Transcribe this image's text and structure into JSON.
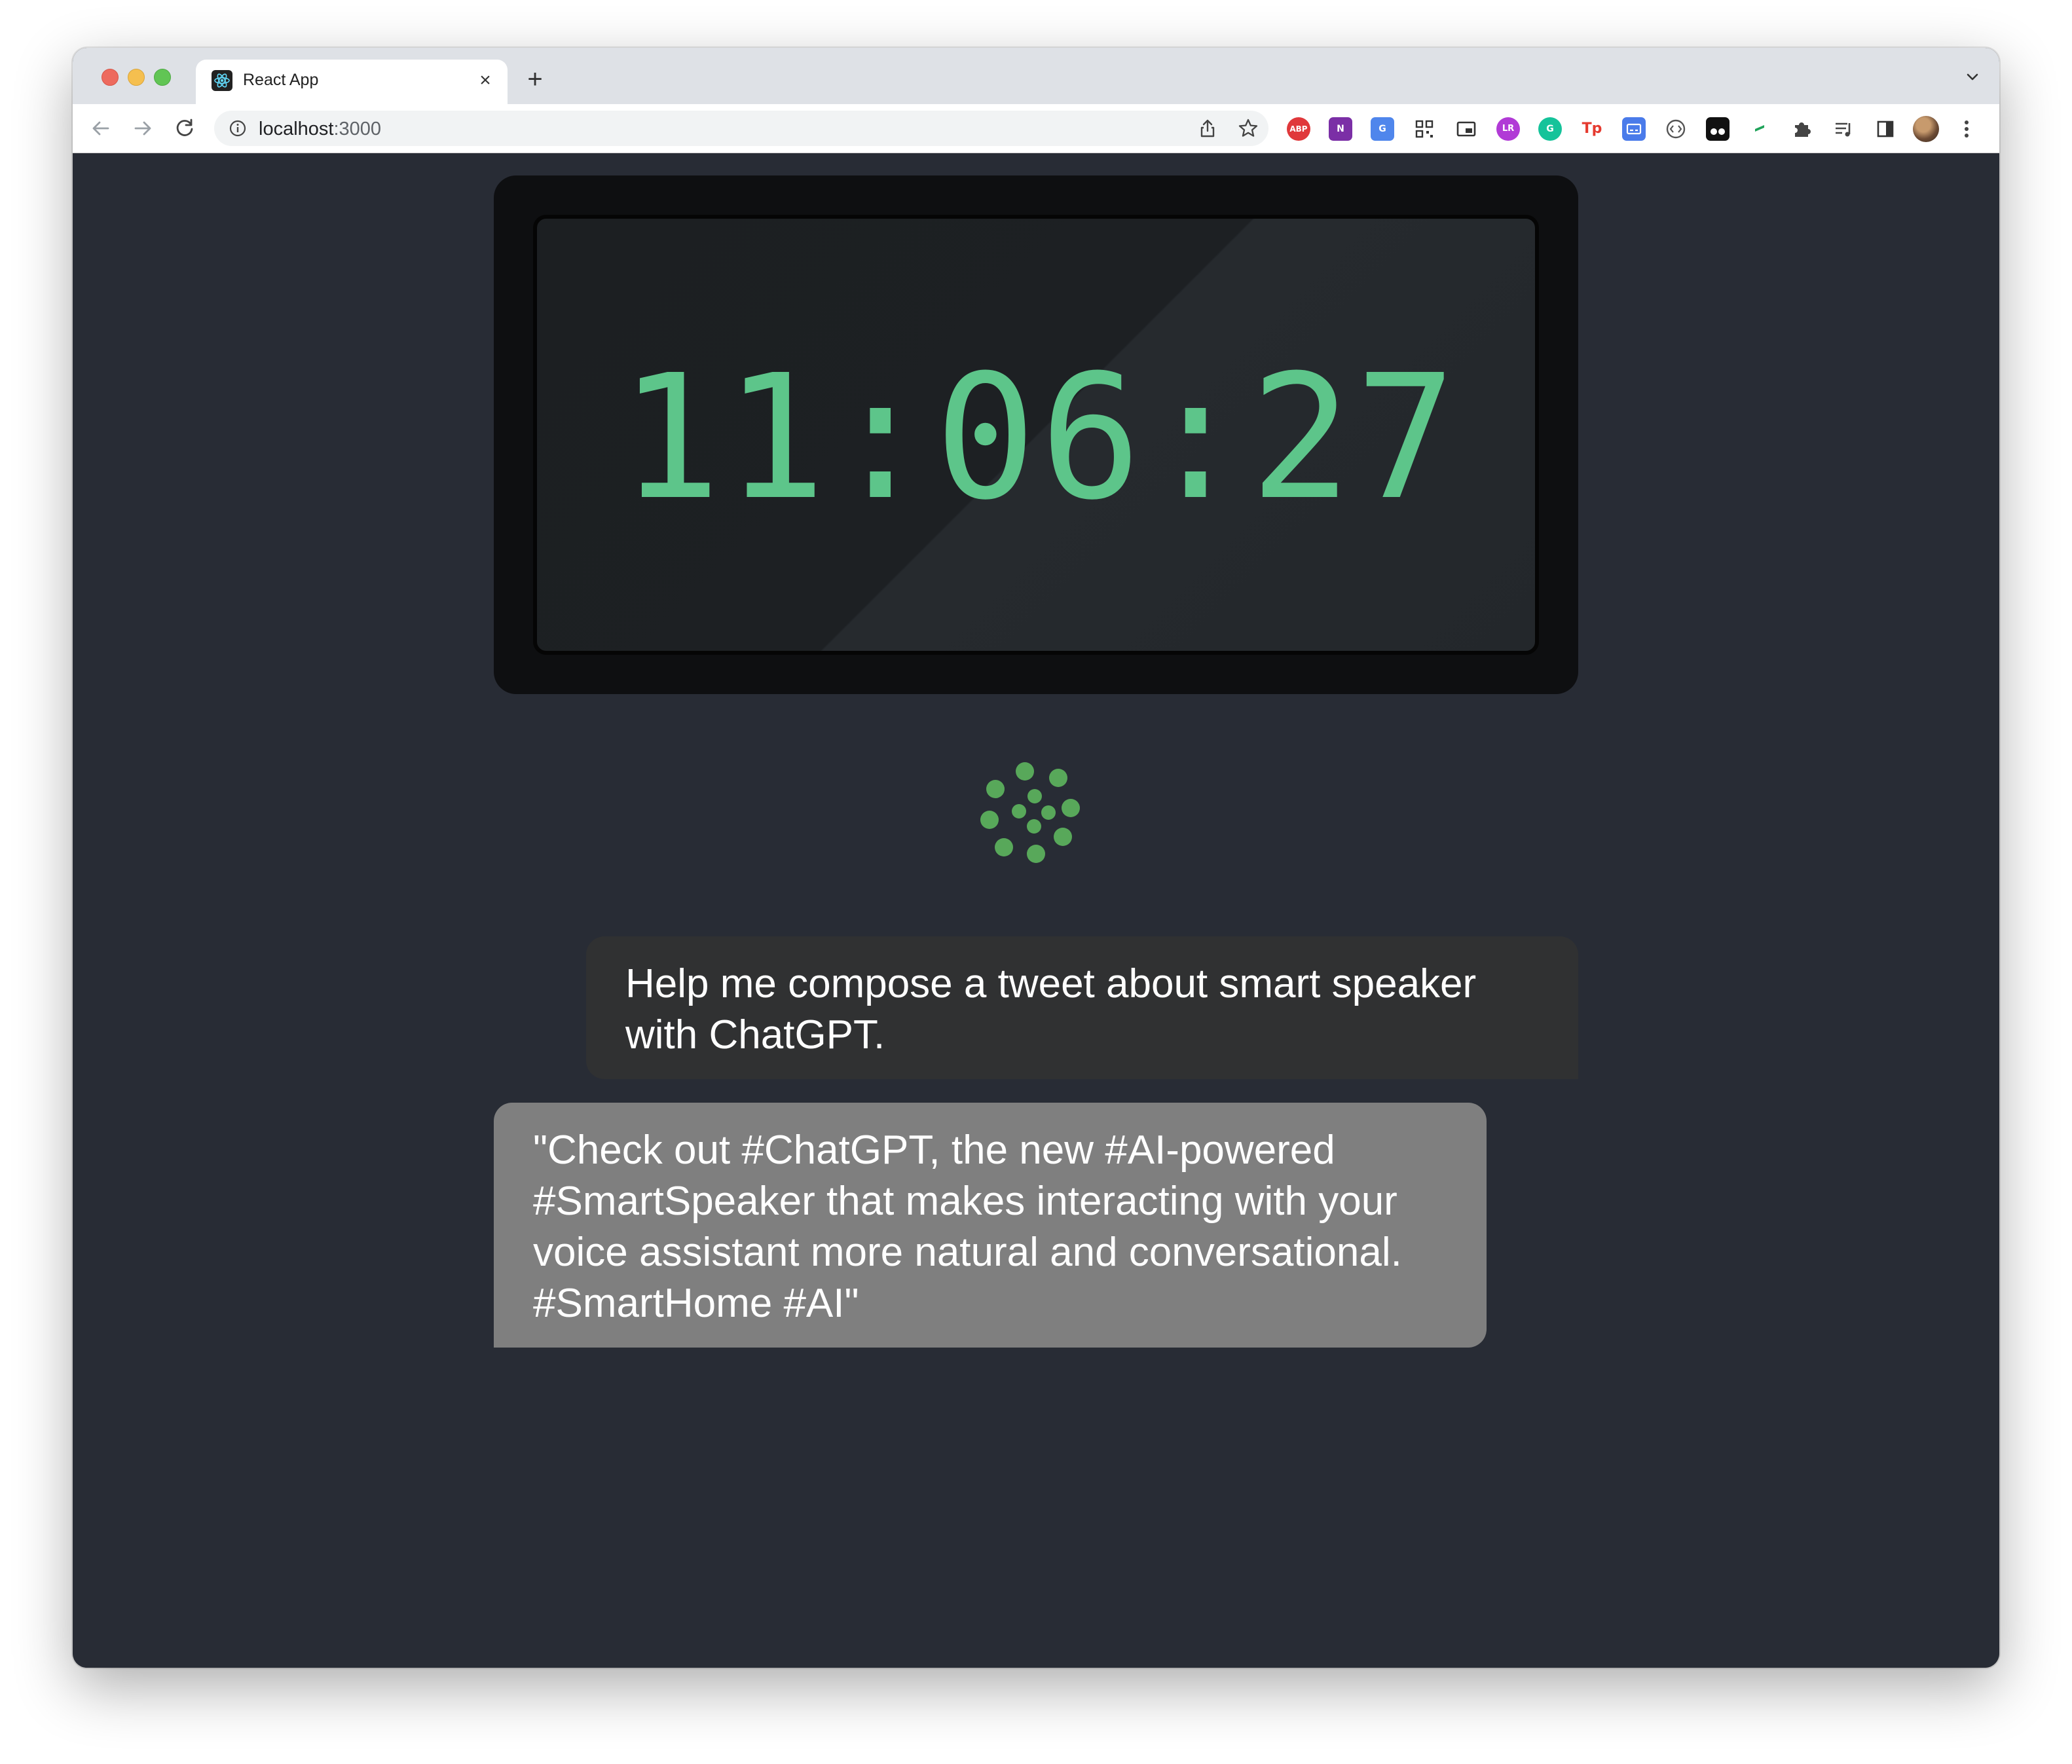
{
  "browser": {
    "tab_title": "React App",
    "tab_close_glyph": "×",
    "new_tab_glyph": "+",
    "url_host": "localhost",
    "url_port": ":3000",
    "icons": {
      "back": "back-arrow-icon",
      "forward": "forward-arrow-icon",
      "reload": "reload-icon",
      "site_info": "info-icon",
      "share": "share-icon",
      "bookmark": "star-icon",
      "tab_search": "chevron-down-icon",
      "extensions": "puzzle-icon",
      "reading_list": "reading-list-icon",
      "side_panel": "side-panel-icon",
      "menu": "kebab-menu-icon"
    },
    "extensions": [
      {
        "name": "adblock-plus-extension-icon",
        "label": "ABP",
        "color": "#e0383b"
      },
      {
        "name": "onenote-extension-icon",
        "label": "N",
        "color": "#7b2fa6"
      },
      {
        "name": "google-translate-extension-icon",
        "label": "G",
        "color": "#4f86ec"
      },
      {
        "name": "qr-code-extension-icon",
        "label": "",
        "color": "#333333"
      },
      {
        "name": "picture-in-picture-extension-icon",
        "label": "",
        "color": "#333333"
      },
      {
        "name": "lr-extension-icon",
        "label": "LR",
        "color": "#b13ad6"
      },
      {
        "name": "grammarly-extension-icon",
        "label": "G",
        "color": "#15c39a"
      },
      {
        "name": "tp-extension-icon",
        "label": "Tp",
        "color": "#e53a2f"
      },
      {
        "name": "subtitles-extension-icon",
        "label": "",
        "color": "#4a7bea"
      },
      {
        "name": "devtools-extension-icon",
        "label": "",
        "color": "#555555"
      },
      {
        "name": "tampermonkey-extension-icon",
        "label": "",
        "color": "#111111"
      },
      {
        "name": "flag-extension-icon",
        "label": "",
        "color": "#20a35a"
      }
    ]
  },
  "clock": {
    "time": "11:06:27",
    "color": "#5dc58a"
  },
  "spinner": {
    "color": "#58a85a"
  },
  "messages": {
    "user": "Help me compose a tweet about smart speaker with ChatGPT.",
    "assistant": "\"Check out #ChatGPT, the new #AI-powered #SmartSpeaker that makes interacting with your voice assistant more natural and conversational. #SmartHome #AI\""
  }
}
